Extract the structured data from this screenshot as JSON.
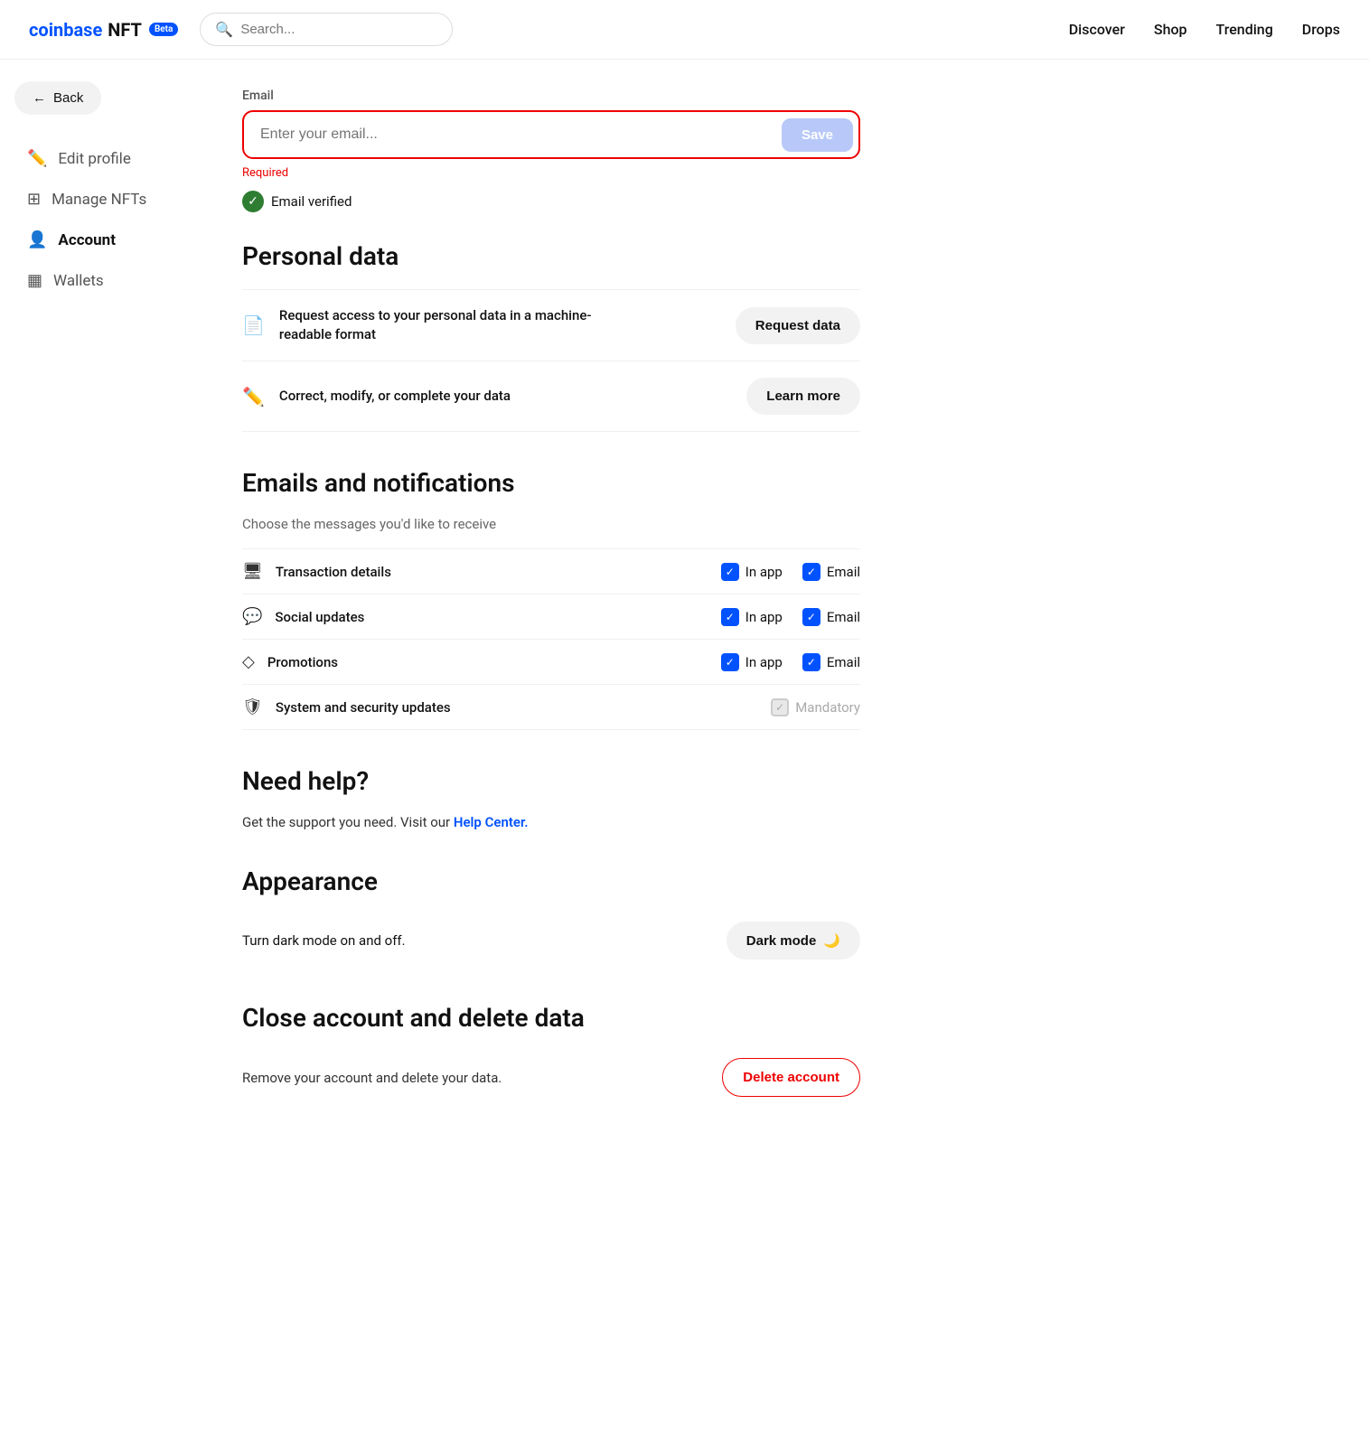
{
  "brand": {
    "coinbase": "coinbase",
    "nft": "NFT",
    "beta": "Beta"
  },
  "search": {
    "placeholder": "Search..."
  },
  "nav": {
    "links": [
      "Discover",
      "Shop",
      "Trending",
      "Drops"
    ]
  },
  "sidebar": {
    "back_label": "Back",
    "items": [
      {
        "id": "edit-profile",
        "label": "Edit profile",
        "icon": "✏️"
      },
      {
        "id": "manage-nfts",
        "label": "Manage NFTs",
        "icon": "⊞"
      },
      {
        "id": "account",
        "label": "Account",
        "icon": "👤"
      },
      {
        "id": "wallets",
        "label": "Wallets",
        "icon": "▦"
      }
    ]
  },
  "email_section": {
    "label": "Email",
    "placeholder": "Enter your email...",
    "save_label": "Save",
    "required_text": "Required",
    "verified_text": "Email verified"
  },
  "personal_data": {
    "heading": "Personal data",
    "rows": [
      {
        "text": "Request access to your personal data in a machine-readable format",
        "action": "Request data"
      },
      {
        "text": "Correct, modify, or complete your data",
        "action": "Learn more"
      }
    ]
  },
  "notifications": {
    "heading": "Emails and notifications",
    "subtitle": "Choose the messages you'd like to receive",
    "rows": [
      {
        "label": "Transaction details",
        "icon": "🖥",
        "in_app": true,
        "email": true,
        "mandatory": false
      },
      {
        "label": "Social updates",
        "icon": "💬",
        "in_app": true,
        "email": true,
        "mandatory": false
      },
      {
        "label": "Promotions",
        "icon": "◇",
        "in_app": true,
        "email": true,
        "mandatory": false
      },
      {
        "label": "System and security updates",
        "icon": "🛡",
        "in_app": false,
        "email": false,
        "mandatory": true
      }
    ],
    "in_app_label": "In app",
    "email_label": "Email",
    "mandatory_label": "Mandatory"
  },
  "need_help": {
    "heading": "Need help?",
    "text": "Get the support you need. Visit our ",
    "link_text": "Help Center."
  },
  "appearance": {
    "heading": "Appearance",
    "text": "Turn dark mode on and off.",
    "dark_mode_label": "Dark mode",
    "dark_mode_icon": "🌙"
  },
  "close_account": {
    "heading": "Close account and delete data",
    "text": "Remove your account and delete your data.",
    "delete_label": "Delete account"
  }
}
